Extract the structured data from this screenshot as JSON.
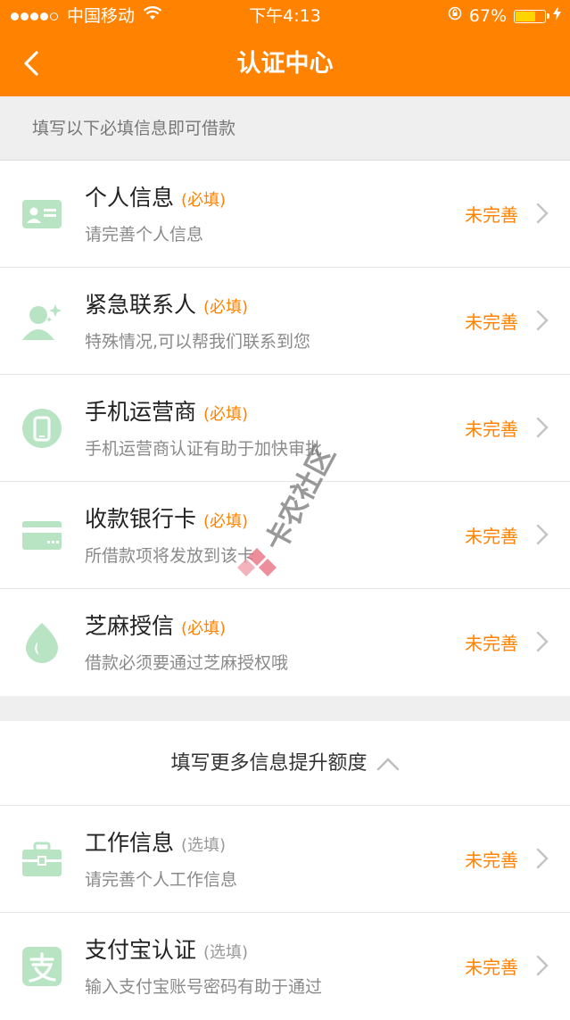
{
  "status_bar": {
    "carrier": "中国移动",
    "time": "下午4:13",
    "battery": "67%"
  },
  "nav": {
    "title": "认证中心"
  },
  "notice": "填写以下必填信息即可借款",
  "required_items": [
    {
      "title": "个人信息",
      "tag": "(必填)",
      "sub": "请完善个人信息",
      "status": "未完善",
      "icon": "id-card-icon"
    },
    {
      "title": "紧急联系人",
      "tag": "(必填)",
      "sub": "特殊情况,可以帮我们联系到您",
      "status": "未完善",
      "icon": "contact-person-icon"
    },
    {
      "title": "手机运营商",
      "tag": "(必填)",
      "sub": "手机运营商认证有助于加快审批",
      "status": "未完善",
      "icon": "mobile-phone-icon"
    },
    {
      "title": "收款银行卡",
      "tag": "(必填)",
      "sub": "所借款项将发放到该卡",
      "status": "未完善",
      "icon": "bank-card-icon"
    },
    {
      "title": "芝麻授信",
      "tag": "(必填)",
      "sub": "借款必须要通过芝麻授权哦",
      "status": "未完善",
      "icon": "sesame-credit-icon"
    }
  ],
  "more_toggle": "填写更多信息提升额度",
  "optional_items": [
    {
      "title": "工作信息",
      "tag": "(选填)",
      "sub": "请完善个人工作信息",
      "status": "未完善",
      "icon": "briefcase-icon"
    },
    {
      "title": "支付宝认证",
      "tag": "(选填)",
      "sub": "输入支付宝账号密码有助于通过",
      "status": "未完善",
      "icon": "alipay-icon"
    }
  ],
  "watermark": "卡农社区",
  "colors": {
    "accent": "#ff8200",
    "icon_green": "#b9e4c4"
  }
}
